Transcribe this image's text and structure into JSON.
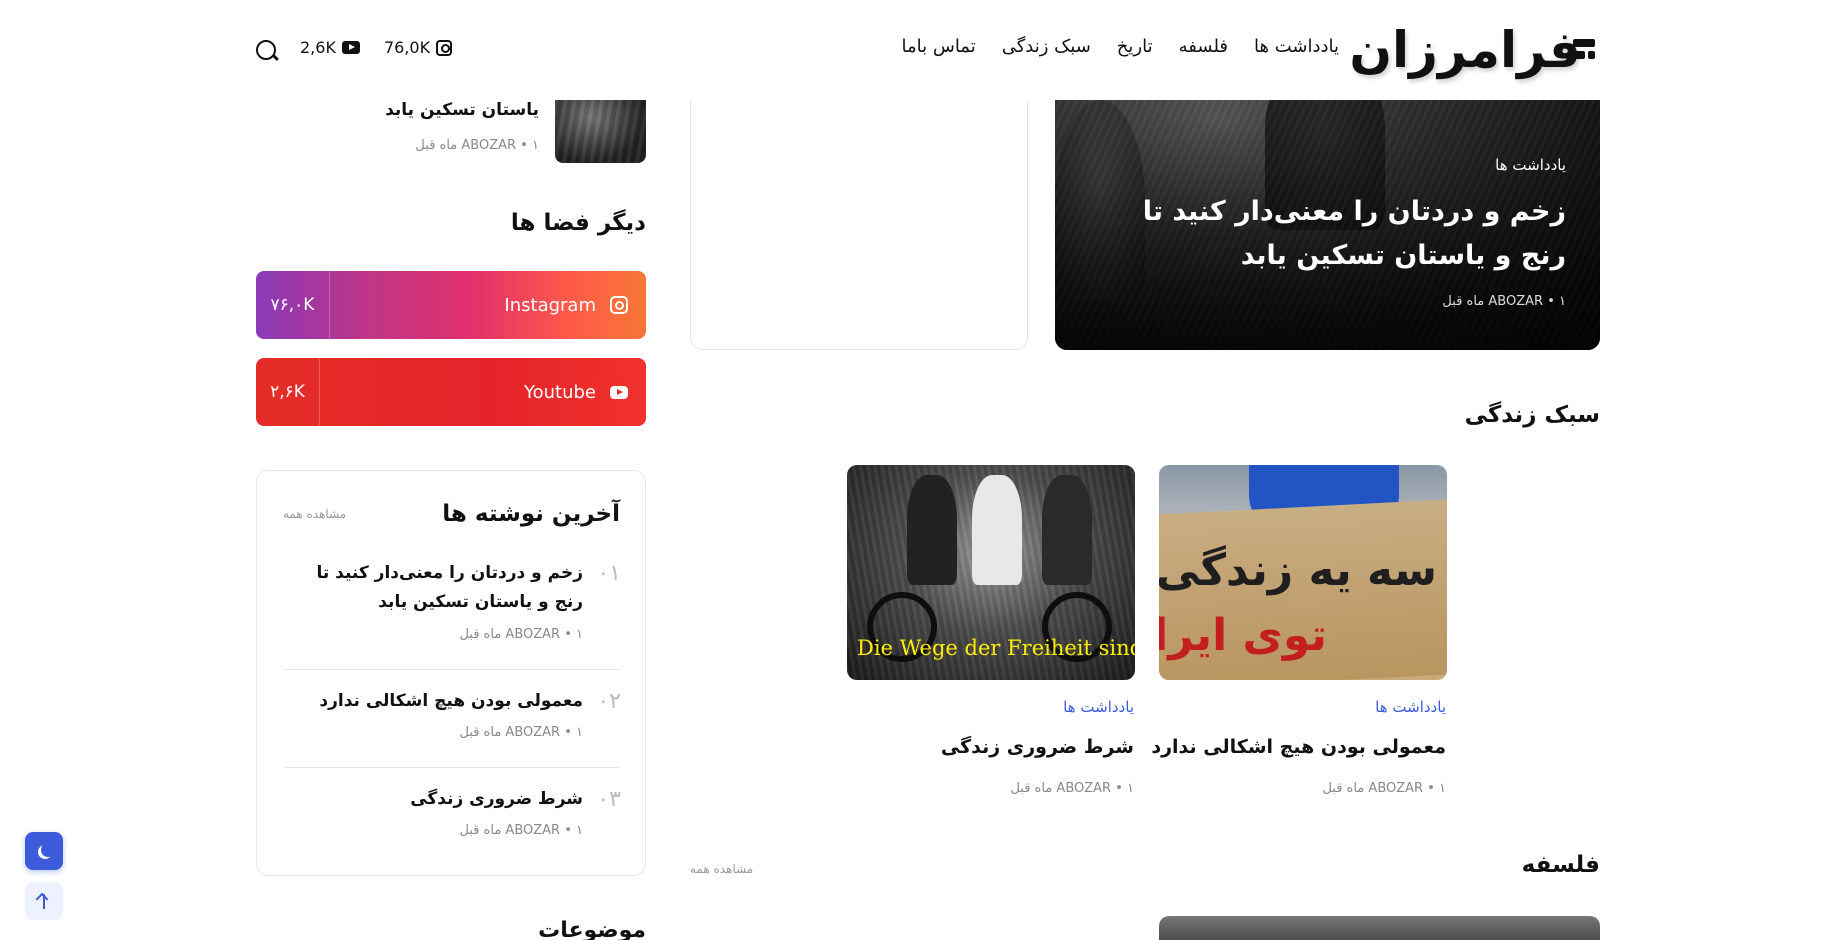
{
  "header": {
    "logo_text": "فرامرزان",
    "nav": [
      "یادداشت ها",
      "فلسفه",
      "تاریخ",
      "سبک زندگی",
      "تماس باما"
    ],
    "instagram_count": "76,0K",
    "youtube_count": "2,6K"
  },
  "hero": {
    "category": "یادداشت ها",
    "title": "زخم و دردتان را معنی‌دار کنید تا رنج و یاستان تسکین یابد",
    "author": "ABOZAR",
    "time": "۱ ماه قبل"
  },
  "sidebar": {
    "top_item_title": "یاستان تسکین یابد",
    "top_item_author": "ABOZAR",
    "top_item_time": "۱ ماه قبل",
    "other_spaces_heading": "دیگر فضا ها",
    "instagram": {
      "name": "Instagram",
      "count": "۷۶,۰K"
    },
    "youtube": {
      "name": "Youtube",
      "count": "۲,۶K"
    },
    "latest": {
      "heading": "آخرین نوشته ها",
      "view_all": "مشاهده همه",
      "items": [
        {
          "num": "۰۱",
          "title": "زخم و دردتان را معنی‌دار کنید تا رنج و یاستان تسکین یابد",
          "author": "ABOZAR",
          "time": "۱ ماه قبل"
        },
        {
          "num": "۰۲",
          "title": "معمولی بودن هیچ اشکالی ندارد",
          "author": "ABOZAR",
          "time": "۱ ماه قبل"
        },
        {
          "num": "۰۳",
          "title": "شرط ضروری زندگی",
          "author": "ABOZAR",
          "time": "۱ ماه قبل"
        }
      ]
    },
    "topics_heading": "موضوعات"
  },
  "lifestyle": {
    "heading": "سبک زندگی",
    "cards": [
      {
        "category": "یادداشت ها",
        "title": "معمولی بودن هیچ اشکالی ندارد",
        "author": "ABOZAR",
        "time": "۱ ماه قبل",
        "image_text_1": "سه یه زندگی معمول",
        "image_text_2": "توی ایران"
      },
      {
        "category": "یادداشت ها",
        "title": "شرط ضروری زندگی",
        "author": "ABOZAR",
        "time": "۱ ماه قبل",
        "image_caption": "Die Wege der Freiheit sind noch immer nicht ganz"
      }
    ]
  },
  "philosophy": {
    "heading": "فلسفه",
    "view_all": "مشاهده همه"
  },
  "colors": {
    "accent": "#3b5bdb",
    "text": "#111111",
    "muted": "#888888"
  }
}
